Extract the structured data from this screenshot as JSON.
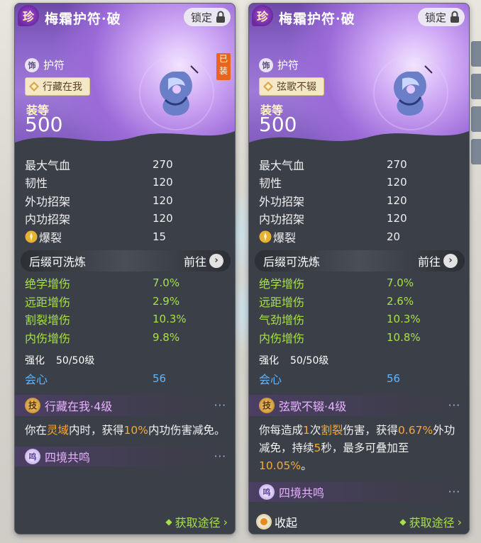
{
  "colors": {
    "accent_purple": "#9b6ad8",
    "green_stat": "#a6e04a",
    "blue_stat": "#5fb6ff",
    "orange_highlight": "#f6a93d"
  },
  "cards": [
    {
      "rarity": "珍",
      "title": "梅霜护符·破",
      "lock_label": "锁定",
      "category_badge": "饰",
      "category": "护符",
      "equipped": "已装",
      "set_name": "行藏在我",
      "score_label": "装等",
      "score": "500",
      "base_stats": [
        {
          "name": "最大气血",
          "value": "270"
        },
        {
          "name": "韧性",
          "value": "120"
        },
        {
          "name": "外功招架",
          "value": "120"
        },
        {
          "name": "内功招架",
          "value": "120"
        },
        {
          "name": "爆裂",
          "value": "15",
          "icon": "burst-icon"
        }
      ],
      "suffix_title": "后缀可洗炼",
      "goto_label": "前往",
      "suffix_stats": [
        {
          "name": "绝学增伤",
          "value": "7.0%"
        },
        {
          "name": "远距增伤",
          "value": "2.9%"
        },
        {
          "name": "割裂增伤",
          "value": "10.3%"
        },
        {
          "name": "内伤增伤",
          "value": "9.8%"
        }
      ],
      "enhance_label": "强化",
      "enhance_value": "50/50级",
      "crit_name": "会心",
      "crit_value": "56",
      "skill_badge": "技",
      "skill_title": "行藏在我·4级",
      "skill_desc": [
        {
          "t": "你在",
          "c": ""
        },
        {
          "t": "灵域",
          "c": "orange"
        },
        {
          "t": "内时，获得",
          "c": ""
        },
        {
          "t": "10%",
          "c": "orange"
        },
        {
          "t": "内功伤害减免。",
          "c": ""
        }
      ],
      "res_badge": "鸣",
      "res_title": "四境共鸣",
      "source_label": "获取途径"
    },
    {
      "rarity": "珍",
      "title": "梅霜护符·破",
      "lock_label": "锁定",
      "category_badge": "饰",
      "category": "护符",
      "set_name": "弦歌不辍",
      "score_label": "装等",
      "score": "500",
      "base_stats": [
        {
          "name": "最大气血",
          "value": "270"
        },
        {
          "name": "韧性",
          "value": "120"
        },
        {
          "name": "外功招架",
          "value": "120"
        },
        {
          "name": "内功招架",
          "value": "120"
        },
        {
          "name": "爆裂",
          "value": "20",
          "icon": "burst-icon"
        }
      ],
      "suffix_title": "后缀可洗炼",
      "goto_label": "前往",
      "suffix_stats": [
        {
          "name": "绝学增伤",
          "value": "7.0%"
        },
        {
          "name": "远距增伤",
          "value": "2.6%"
        },
        {
          "name": "气劲增伤",
          "value": "10.3%"
        },
        {
          "name": "内伤增伤",
          "value": "10.8%"
        }
      ],
      "enhance_label": "强化",
      "enhance_value": "50/50级",
      "crit_name": "会心",
      "crit_value": "56",
      "skill_badge": "技",
      "skill_title": "弦歌不辍·4级",
      "skill_desc": [
        {
          "t": "你每造成",
          "c": ""
        },
        {
          "t": "1",
          "c": "orange"
        },
        {
          "t": "次",
          "c": ""
        },
        {
          "t": "割裂",
          "c": "orange"
        },
        {
          "t": "伤害，获得",
          "c": ""
        },
        {
          "t": "0.67%",
          "c": "orange"
        },
        {
          "t": "外功减免，持续",
          "c": ""
        },
        {
          "t": "5",
          "c": "orange"
        },
        {
          "t": "秒，最多可叠加至",
          "c": ""
        },
        {
          "t": "10.05%",
          "c": "orange"
        },
        {
          "t": "。",
          "c": ""
        }
      ],
      "res_badge": "鸣",
      "res_title": "四境共鸣",
      "collapse_label": "收起",
      "source_label": "获取途径"
    }
  ]
}
